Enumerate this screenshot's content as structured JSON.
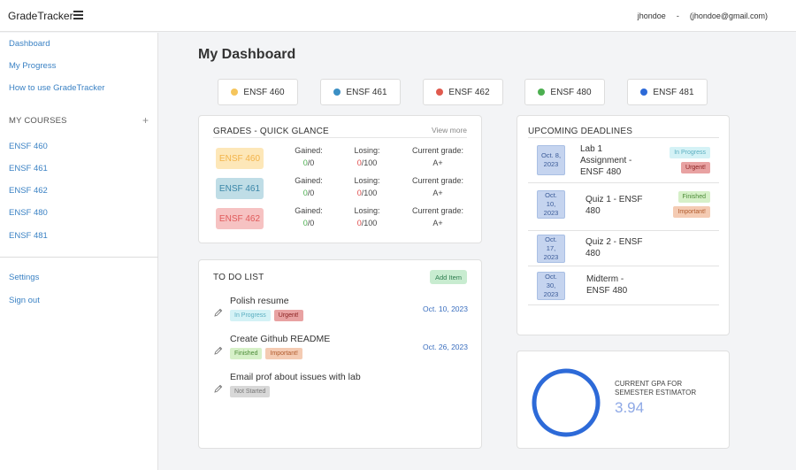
{
  "topbar": {
    "brand": "GradeTracker",
    "username": "jhondoe",
    "separator": "-",
    "email": "(jhondoe@gmail.com)"
  },
  "sidebar": {
    "nav": [
      {
        "label": "Dashboard"
      },
      {
        "label": "My Progress"
      },
      {
        "label": "How to use GradeTracker"
      }
    ],
    "courses_title": "MY COURSES",
    "add_symbol": "+",
    "courses": [
      {
        "label": "ENSF 460"
      },
      {
        "label": "ENSF 461"
      },
      {
        "label": "ENSF 462"
      },
      {
        "label": "ENSF 480"
      },
      {
        "label": "ENSF 481"
      }
    ],
    "bottom": [
      {
        "label": "Settings"
      },
      {
        "label": "Sign out"
      }
    ]
  },
  "page_title": "My Dashboard",
  "course_pills": [
    {
      "label": "ENSF 460",
      "color": "#f5c55c"
    },
    {
      "label": "ENSF 461",
      "color": "#3b8fc4"
    },
    {
      "label": "ENSF 462",
      "color": "#e05a4e"
    },
    {
      "label": "ENSF 480",
      "color": "#4caf50"
    },
    {
      "label": "ENSF 481",
      "color": "#2d6ad8"
    }
  ],
  "grades": {
    "title": "GRADES - QUICK GLANCE",
    "view_more": "View more",
    "rows": [
      {
        "course": "ENSF 460",
        "gained_label": "Gained:",
        "gained": "0",
        "gained_total": "/0",
        "losing_label": "Losing:",
        "losing": "0",
        "losing_total": "/100",
        "current_label": "Current grade:",
        "current": "A+",
        "bg": "#fde7b8",
        "fg": "#f2b34a"
      },
      {
        "course": "ENSF 461",
        "gained_label": "Gained:",
        "gained": "0",
        "gained_total": "/0",
        "losing_label": "Losing:",
        "losing": "0",
        "losing_total": "/100",
        "current_label": "Current grade:",
        "current": "A+",
        "bg": "#bfdde6",
        "fg": "#3a86a8"
      },
      {
        "course": "ENSF 462",
        "gained_label": "Gained:",
        "gained": "0",
        "gained_total": "/0",
        "losing_label": "Losing:",
        "losing": "0",
        "losing_total": "/100",
        "current_label": "Current grade:",
        "current": "A+",
        "bg": "#f6c2c2",
        "fg": "#e05a5a"
      }
    ]
  },
  "todo": {
    "title": "TO DO LIST",
    "add_label": "Add Item",
    "items": [
      {
        "name": "Polish resume",
        "tags": [
          {
            "label": "In Progress",
            "cls": "t-inprogress"
          },
          {
            "label": "Urgent!",
            "cls": "t-urgent"
          }
        ],
        "date": "Oct. 10, 2023"
      },
      {
        "name": "Create Github README",
        "tags": [
          {
            "label": "Finished",
            "cls": "t-finished"
          },
          {
            "label": "Important!",
            "cls": "t-important"
          }
        ],
        "date": "Oct. 26, 2023"
      },
      {
        "name": "Email prof about issues with lab",
        "tags": [
          {
            "label": "Not Started",
            "cls": "t-notstarted"
          }
        ],
        "date": ""
      }
    ]
  },
  "deadlines": {
    "title": "UPCOMING DEADLINES",
    "items": [
      {
        "date": "Oct. 8, 2023",
        "name": "Lab 1 Assignment - ENSF 480",
        "tags": [
          {
            "label": "In Progress",
            "cls": "t-inprogress"
          },
          {
            "label": "Urgent!",
            "cls": "t-urgent"
          }
        ]
      },
      {
        "date": "Oct. 10, 2023",
        "name": "Quiz 1 - ENSF 480",
        "tags": [
          {
            "label": "Finished",
            "cls": "t-finished"
          },
          {
            "label": "Important!",
            "cls": "t-important"
          }
        ]
      },
      {
        "date": "Oct. 17, 2023",
        "name": "Quiz 2 - ENSF 480",
        "tags": []
      },
      {
        "date": "Oct. 30, 2023",
        "name": "Midterm - ENSF 480",
        "tags": []
      }
    ]
  },
  "gpa": {
    "label": "CURRENT GPA FOR SEMESTER ESTIMATOR",
    "value": "3.94",
    "ring_color": "#2d6ad8"
  }
}
